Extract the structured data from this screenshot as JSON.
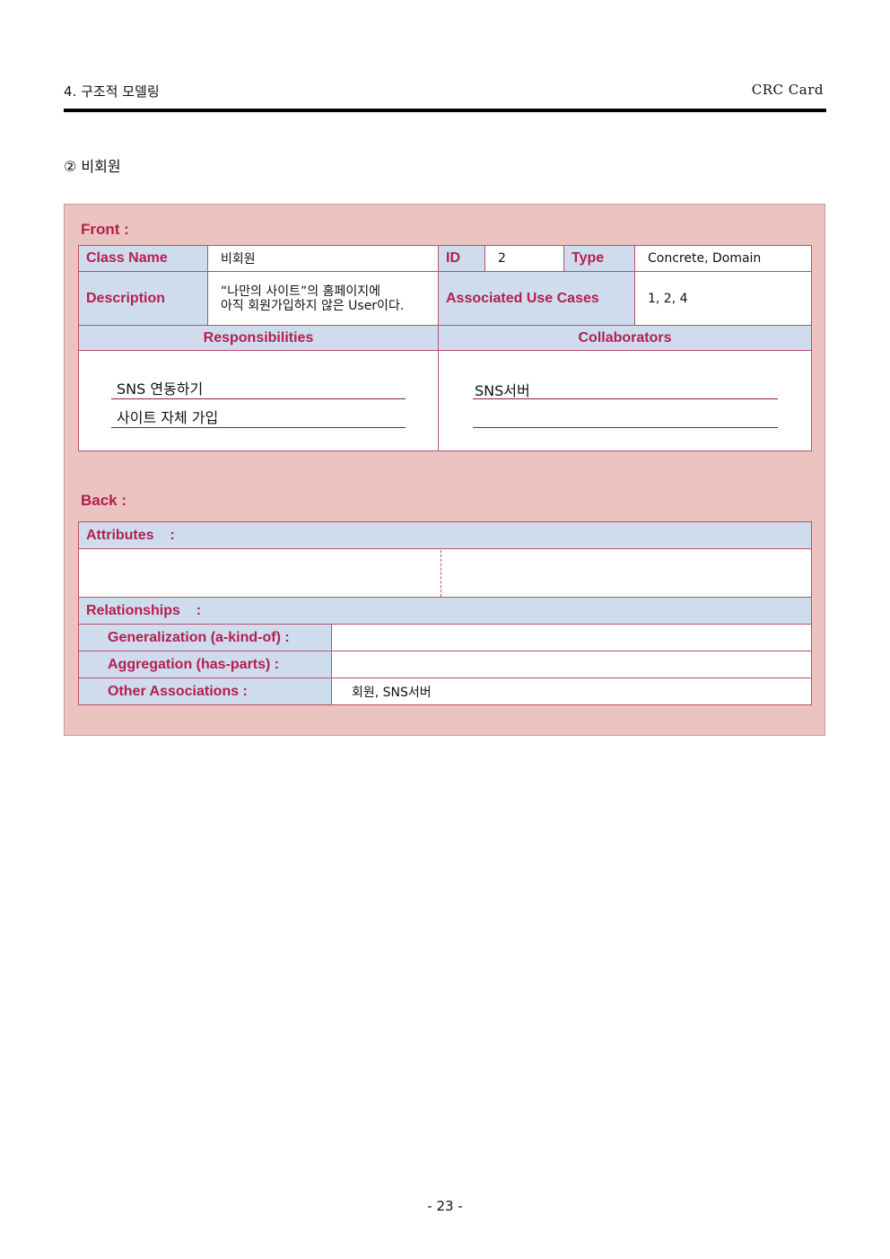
{
  "header": {
    "left": "4. 구조적 모델링",
    "right": "CRC Card"
  },
  "section_title": "② 비회원",
  "front": {
    "label": "Front :",
    "class_name_label": "Class Name",
    "class_name_value": "비회원",
    "id_label": "ID",
    "id_value": "2",
    "type_label": "Type",
    "type_value": "Concrete, Domain",
    "description_label": "Description",
    "description_line1": "“나만의 사이트”의 홈페이지에",
    "description_line2": "아직 회원가입하지 않은 User이다.",
    "use_cases_label": "Associated Use Cases",
    "use_cases_value": "1, 2, 4",
    "responsibilities_label": "Responsibilities",
    "collaborators_label": "Collaborators",
    "responsibilities": [
      "SNS 연동하기",
      "사이트 자체 가입"
    ],
    "collaborators": [
      "SNS서버",
      ""
    ]
  },
  "back": {
    "label": "Back :",
    "attributes_label": "Attributes    :",
    "relationships_label": "Relationships    :",
    "generalization_label": "Generalization (a-kind-of) :",
    "generalization_value": "",
    "aggregation_label": "Aggregation (has-parts) :",
    "aggregation_value": "",
    "other_label": "Other Associations :",
    "other_value": "회원, SNS서버"
  },
  "page_number": "- 23 -"
}
